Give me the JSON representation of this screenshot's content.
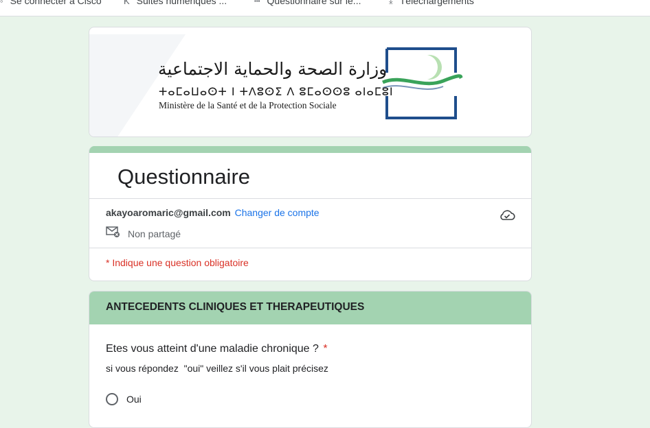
{
  "bookmarks": [
    {
      "label": "Se connecter à Cisco",
      "icon": "cisco-icon"
    },
    {
      "label": "Suites numériques  ...",
      "icon": "k-icon"
    },
    {
      "label": "Questionnaire sur le...",
      "icon": "cisco-icon"
    },
    {
      "label": "Téléchargements",
      "icon": "download-icon"
    }
  ],
  "banner": {
    "arabic": "وزارة الصحة والحماية الاجتماعية",
    "tifinagh": "ⵜⴰⵎⴰⵡⴰⵙⵜ ⵏ ⵜⴷⵓⵙⵉ ⴷ ⵓⵎⴰⵙⵙⵓ ⴰⵏⴰⵎⵓⵏ",
    "french": "Ministère de la Santé et de la Protection Sociale"
  },
  "form": {
    "title": "Questionnaire",
    "account_email": "akayoaromaric@gmail.com",
    "switch_account": "Changer de compte",
    "share_status": "Non partagé",
    "required_note": "* Indique une question obligatoire"
  },
  "section": {
    "title": "ANTECEDENTS CLINIQUES ET THERAPEUTIQUES",
    "question": "Etes vous atteint d'une maladie chronique ?",
    "required_mark": "*",
    "hint": "si vous répondez  \"oui\" veillez s'il vous plait précisez",
    "options": [
      "Oui"
    ]
  },
  "colors": {
    "accent": "#a3d3b1",
    "page_bg": "#e8f4ea",
    "link": "#1a73e8",
    "required": "#d93025",
    "logo_blue": "#1f4e8c",
    "logo_green": "#3aa35a"
  }
}
